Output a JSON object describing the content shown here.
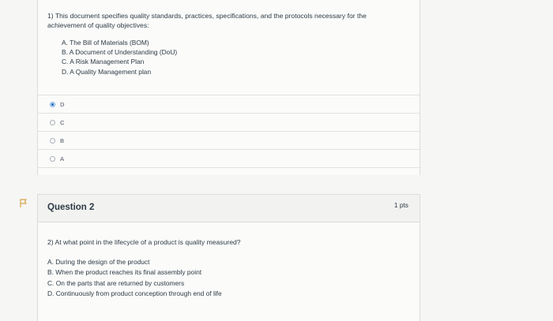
{
  "question1": {
    "text_line1": "1) This document specifies quality standards, practices, specifications, and the protocols necessary for the",
    "text_line2": "achievement of quality objectives:",
    "options": [
      "A. The Bill of Materials (BOM)",
      "B. A Document of Understanding (DoU)",
      "C. A Risk Management Plan",
      "D. A Quality Management plan"
    ],
    "answers": [
      {
        "label": "D",
        "selected": true
      },
      {
        "label": "C",
        "selected": false
      },
      {
        "label": "B",
        "selected": false
      },
      {
        "label": "A",
        "selected": false
      }
    ]
  },
  "question2": {
    "title": "Question 2",
    "points": "1 pts",
    "text": "2) At what point in the lifecycle of a product is quality measured?",
    "options": [
      "A. During the design of the product",
      "B. When the product reaches its final assembly point",
      "C. On the parts that are returned by customers",
      "D. Continuously from product conception through end of life"
    ]
  },
  "colors": {
    "accent": "#2b6fbf",
    "text": "#2d3b45",
    "flag": "#d6a24a"
  },
  "icons": {
    "flag": "flag-icon",
    "radio": "radio-button-icon"
  }
}
